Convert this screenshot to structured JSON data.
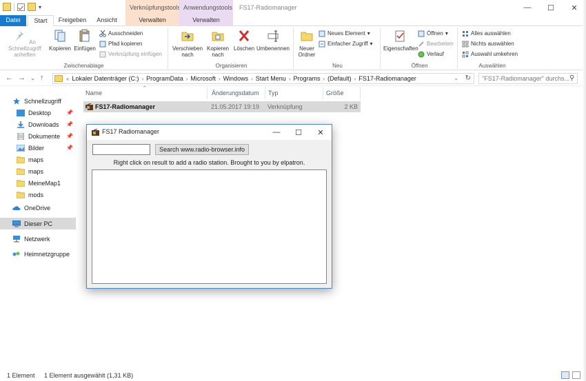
{
  "window": {
    "title": "FS17-Radiomanager",
    "context_tab_1": "Verknüpfungstools",
    "context_tab_2": "Anwendungstools"
  },
  "ribbon_tabs": {
    "datei": "Datei",
    "start": "Start",
    "freigeben": "Freigeben",
    "ansicht": "Ansicht",
    "verwalten_1": "Verwalten",
    "verwalten_2": "Verwalten"
  },
  "ribbon": {
    "clipboard": {
      "label": "Zwischenablage",
      "pin": "An Schnellzugriff anheften",
      "copy": "Kopieren",
      "paste": "Einfügen",
      "cut": "Ausschneiden",
      "copy_path": "Pfad kopieren",
      "paste_shortcut": "Verknüpfung einfügen"
    },
    "organize": {
      "label": "Organisieren",
      "move_to": "Verschieben nach",
      "copy_to": "Kopieren nach",
      "delete": "Löschen",
      "rename": "Umbenennen"
    },
    "new": {
      "label": "Neu",
      "new_folder": "Neuer Ordner",
      "new_item": "Neues Element",
      "easy_access": "Einfacher Zugriff"
    },
    "open": {
      "label": "Öffnen",
      "properties": "Eigenschaften",
      "open": "Öffnen",
      "edit": "Bearbeiten",
      "history": "Verlauf"
    },
    "select": {
      "label": "Auswählen",
      "select_all": "Alles auswählen",
      "select_none": "Nichts auswählen",
      "invert": "Auswahl umkehren"
    }
  },
  "address": {
    "crumbs": [
      "Lokaler Datenträger (C:)",
      "ProgramData",
      "Microsoft",
      "Windows",
      "Start Menu",
      "Programs",
      "(Default)",
      "FS17-Radiomanager"
    ],
    "search_placeholder": "\"FS17-Radiomanager\" durchs..."
  },
  "nav": {
    "quick_access": "Schnellzugriff",
    "items": [
      "Desktop",
      "Downloads",
      "Dokumente",
      "Bilder",
      "maps",
      "maps",
      "MeineMap1",
      "mods"
    ],
    "onedrive": "OneDrive",
    "this_pc": "Dieser PC",
    "network": "Netzwerk",
    "homegroup": "Heimnetzgruppe"
  },
  "columns": {
    "name": "Name",
    "date": "Änderungsdatum",
    "type": "Typ",
    "size": "Größe"
  },
  "files": [
    {
      "name": "FS17-Radiomanager",
      "date": "21.05.2017 19:19",
      "type": "Verknüpfung",
      "size": "2 KB"
    }
  ],
  "status": {
    "count": "1 Element",
    "selected": "1 Element ausgewählt (1,31 KB)"
  },
  "dialog": {
    "title": "FS17 Radiomanager",
    "search_button": "Search www.radio-browser.info",
    "search_value": "",
    "hint": "Right click on result to add a radio station. Brought to you by elpatron."
  },
  "colors": {
    "accent": "#1979ca",
    "selection": "#d9d9d9",
    "context_orange": "#fbe1cd",
    "context_purple": "#eadbf2"
  }
}
